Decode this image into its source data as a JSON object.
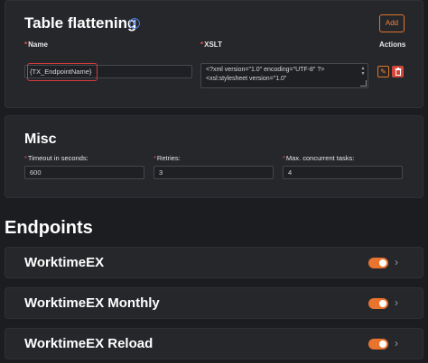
{
  "table_flattening": {
    "title": "Table flattening",
    "info_glyph": "i",
    "add_label": "Add",
    "columns": {
      "required_mark": "*",
      "name": "Name",
      "xslt": "XSLT",
      "actions": "Actions"
    },
    "row": {
      "name_value": "{TX_EndpointName}",
      "xslt_lines": [
        "<?xml version=\"1.0\" encoding=\"UTF-8\" ?>",
        "<xsl:stylesheet version=\"1.0\""
      ],
      "edit_icon": "✎",
      "delete_icon": "🗑"
    }
  },
  "misc": {
    "title": "Misc",
    "timeout_label": "Timeout in seconds:",
    "timeout_value": "600",
    "retries_label": "Retries:",
    "retries_value": "3",
    "max_tasks_label": "Max. concurrent tasks:",
    "max_tasks_value": "4"
  },
  "endpoints": {
    "title": "Endpoints",
    "items": [
      {
        "label": "WorktimeEX",
        "enabled": true
      },
      {
        "label": "WorktimeEX Monthly",
        "enabled": true
      },
      {
        "label": "WorktimeEX Reload",
        "enabled": true
      }
    ],
    "chevron": "›"
  },
  "colors": {
    "accent": "#e8742e",
    "danger": "#d2463a",
    "info": "#4f7fe0",
    "background": "#1c1d21",
    "panel": "#26272b"
  }
}
